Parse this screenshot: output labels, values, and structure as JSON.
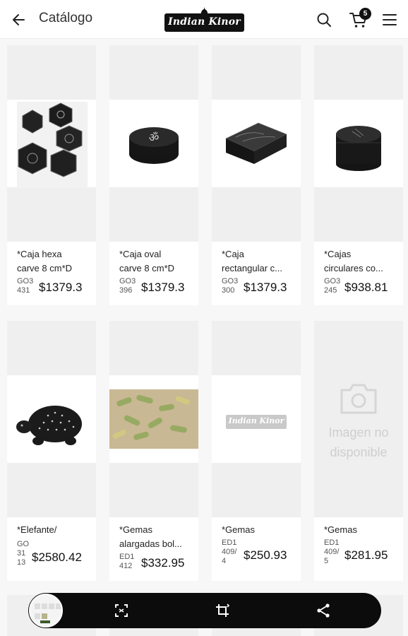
{
  "header": {
    "title": "Catálogo",
    "logo_text": "Indian Kinor",
    "cart_count": "5"
  },
  "products": [
    {
      "name_line1": "*Caja hexa",
      "name_line2": "carve 8 cm*D",
      "code": "GO3 431",
      "price": "$1379.3",
      "image": "hexagonal-boxes-photo"
    },
    {
      "name_line1": "*Caja oval",
      "name_line2": "carve 8 cm*D",
      "code": "GO3 396",
      "price": "$1379.3",
      "image": "oval-om-box-photo"
    },
    {
      "name_line1": "*Caja",
      "name_line2": "rectangular c...",
      "code": "GO3 300",
      "price": "$1379.3",
      "image": "rectangular-box-photo"
    },
    {
      "name_line1": "*Cajas",
      "name_line2": "circulares co...",
      "code": "GO3 245",
      "price": "$938.81",
      "image": "round-box-photo"
    },
    {
      "name_line1": "*Elefante/",
      "name_line2": "",
      "code": "GO 31 13",
      "price": "$2580.42",
      "image": "turtle-figure-photo"
    },
    {
      "name_line1": "*Gemas",
      "name_line2": "alargadas bol...",
      "code": "ED1 412",
      "price": "$332.95",
      "image": "gems-bag-photo"
    },
    {
      "name_line1": "*Gemas",
      "name_line2": "",
      "code": "ED1 409/ 4",
      "price": "$250.93",
      "image": "indian-kinor-logo-placeholder",
      "logo_text": "Indian Kinor"
    },
    {
      "name_line1": "*Gemas",
      "name_line2": "",
      "code": "ED1 409/ 5",
      "price": "$281.95",
      "image": "no-image",
      "no_image_text": "Imagen no disponible"
    }
  ],
  "toolbar": {
    "icons": [
      "thumbnail",
      "scan-icon",
      "crop-rotate-icon",
      "share-icon"
    ]
  },
  "colors": {
    "background": "#f7f7f7",
    "card": "#ffffff",
    "placeholder": "#efefef",
    "toolbar": "#0c0c0c"
  }
}
